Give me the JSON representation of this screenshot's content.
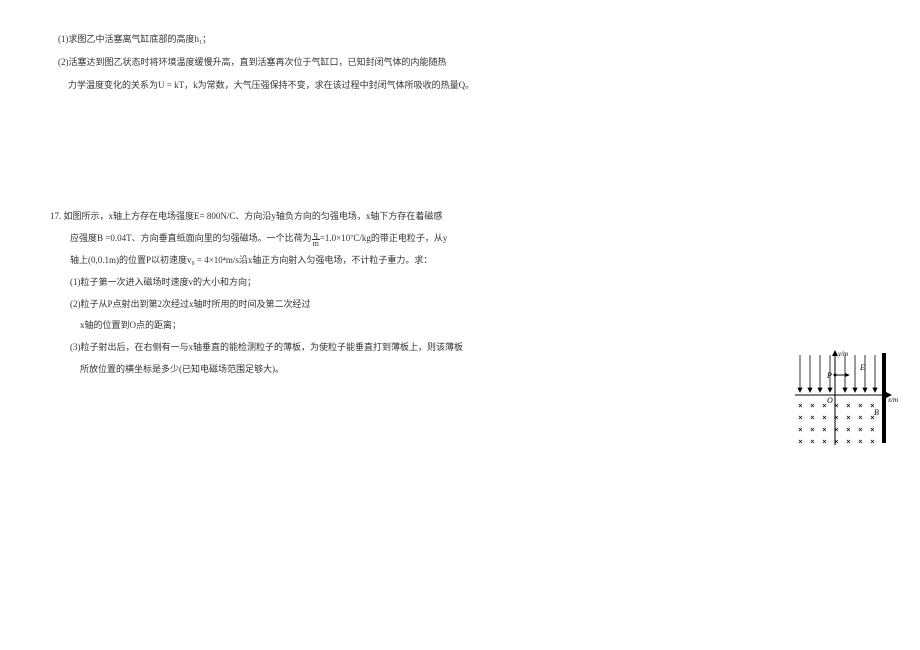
{
  "q16": {
    "part1": "(1)求图乙中活塞离气缸底部的高度h₁；",
    "part2": "(2)活塞达到图乙状态时将环境温度缓慢升高，直到活塞再次位于气缸口，已知封闭气体的内能随热",
    "part2b": "力学温度变化的关系为U = kT，k为常数，大气压强保持不变，求在该过程中封闭气体所吸收的热量Q。"
  },
  "q17": {
    "num": "17.",
    "stem1": "如图所示，x轴上方存在电场强度E= 800N/C、方向沿y轴负方向的匀强电场，x轴下方存在着磁感",
    "stem2_a": "应强度B =0.04T、方向垂直纸面向里的匀强磁场。一个比荷为",
    "stem2_b": "=1.0×10⁷C/kg的带正电粒子，从y",
    "frac_num": "q",
    "frac_den": "m",
    "stem3": "轴上(0,0.1m)的位置P以初速度v₀ = 4×10⁴m/s沿x轴正方向射入匀强电场，不计粒子重力。求：",
    "p1": "(1)粒子第一次进入磁场时速度v的大小和方向；",
    "p2a": "(2)粒子从P点射出到第2次经过x轴时所用的时间及第二次经过",
    "p2b": "x轴的位置到O点的距离；",
    "p3a": "(3)粒子射出后，在右侧有一与x轴垂直的能检测粒子的薄板，为使粒子能垂直打到薄板上，则该薄板",
    "p3b": "所放位置的横坐标是多少(已知电磁场范围足够大)。"
  },
  "diagram": {
    "ylabel": "y/m",
    "xlabel": "x/m",
    "E": "E",
    "P": "P",
    "O": "O",
    "B": "B"
  }
}
